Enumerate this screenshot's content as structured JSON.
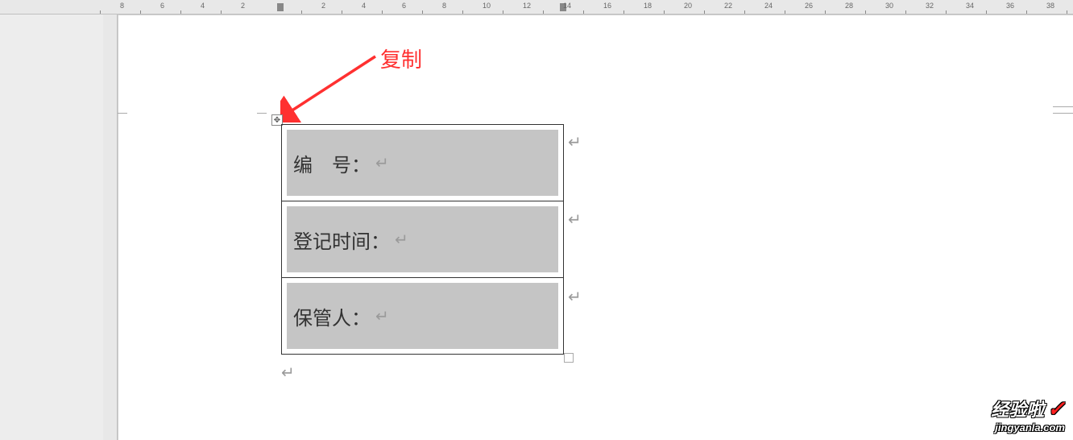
{
  "annotation": {
    "label": "复制"
  },
  "table": {
    "rows": [
      {
        "label": "编　号："
      },
      {
        "label": "登记时间："
      },
      {
        "label": "保管人："
      }
    ]
  },
  "ruler": {
    "left_negatives": [
      "8",
      "6",
      "4",
      "2"
    ],
    "right_start": 2,
    "right_end": 40,
    "step": 2
  },
  "symbols": {
    "return": "↵",
    "anchor": "✥"
  },
  "watermark": {
    "main": "经验啦",
    "check": "✓",
    "sub": "jingyanla.com"
  }
}
